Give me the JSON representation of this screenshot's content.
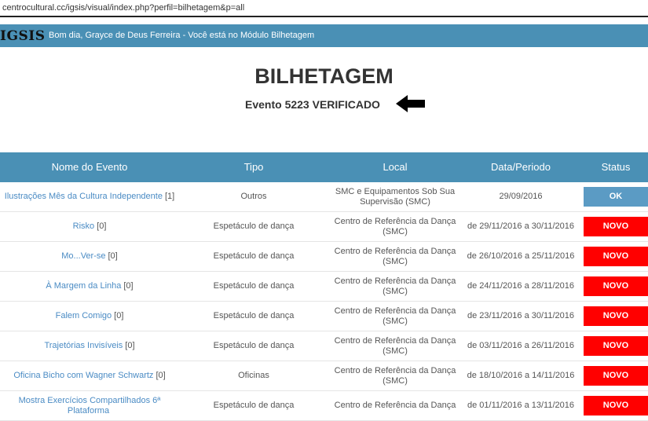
{
  "browser": {
    "url": "centrocultural.cc/igsis/visual/index.php?perfil=bilhetagem&p=all"
  },
  "topbar": {
    "brand": "IGSIS",
    "greeting": "Bom dia, Grayce de Deus Ferreira - Você está no Módulo Bilhetagem"
  },
  "page": {
    "title": "BILHETAGEM",
    "subtitle": "Evento 5223 VERIFICADO"
  },
  "table": {
    "headers": [
      "Nome do Evento",
      "Tipo",
      "Local",
      "Data/Periodo",
      "Status"
    ],
    "rows": [
      {
        "name": "Ilustrações Mês da Cultura Independente",
        "count": "[1]",
        "tipo": "Outros",
        "local": "SMC e Equipamentos Sob Sua Supervisão (SMC)",
        "data": "29/09/2016",
        "status": "OK"
      },
      {
        "name": "Risko",
        "count": "[0]",
        "tipo": "Espetáculo de dança",
        "local": "Centro de Referência da Dança (SMC)",
        "data": "de 29/11/2016 a 30/11/2016",
        "status": "NOVO"
      },
      {
        "name": "Mo...Ver-se",
        "count": "[0]",
        "tipo": "Espetáculo de dança",
        "local": "Centro de Referência da Dança (SMC)",
        "data": "de 26/10/2016 a 25/11/2016",
        "status": "NOVO"
      },
      {
        "name": "À Margem da Linha",
        "count": "[0]",
        "tipo": "Espetáculo de dança",
        "local": "Centro de Referência da Dança (SMC)",
        "data": "de 24/11/2016 a 28/11/2016",
        "status": "NOVO"
      },
      {
        "name": "Falem Comigo",
        "count": "[0]",
        "tipo": "Espetáculo de dança",
        "local": "Centro de Referência da Dança (SMC)",
        "data": "de 23/11/2016 a 30/11/2016",
        "status": "NOVO"
      },
      {
        "name": "Trajetórias Invisíveis",
        "count": "[0]",
        "tipo": "Espetáculo de dança",
        "local": "Centro de Referência da Dança (SMC)",
        "data": "de 03/11/2016 a 26/11/2016",
        "status": "NOVO"
      },
      {
        "name": "Oficina Bicho com Wagner Schwartz",
        "count": "[0]",
        "tipo": "Oficinas",
        "local": "Centro de Referência da Dança (SMC)",
        "data": "de 18/10/2016 a 14/11/2016",
        "status": "NOVO"
      },
      {
        "name": "Mostra Exercícios Compartilhados 6ª Plataforma",
        "count": "",
        "tipo": "Espetáculo de dança",
        "local": "Centro de Referência da Dança",
        "data": "de 01/11/2016 a 13/11/2016",
        "status": "NOVO"
      }
    ]
  },
  "colors": {
    "header_bg": "#4a90b5",
    "ok": "#5b9bc4",
    "novo": "#ff0000",
    "link": "#4a8bc4"
  },
  "icons": {
    "arrow": "arrow-left-icon"
  }
}
